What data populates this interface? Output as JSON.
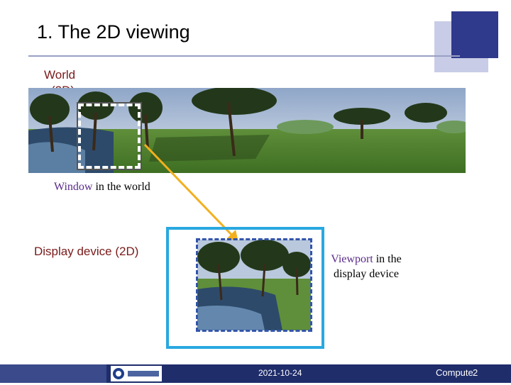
{
  "slide": {
    "title": "1. The 2D viewing",
    "world_label_line1": "World",
    "world_label_line2": "(2D)",
    "window_label_accent": "Window",
    "window_label_rest": " in the world",
    "display_label": "Display device (2D)",
    "viewport_label_accent": "Viewport",
    "viewport_label_rest": " in the display device"
  },
  "footer": {
    "date": "2021-10-24",
    "course": "Compute",
    "page": "2",
    "logo_text": "한양대학교"
  },
  "colors": {
    "accent_purple": "#5a2a8a",
    "label_dark_red": "#7a1a1a",
    "arrow_orange": "#f2b01e",
    "frame_cyan": "#29a8e0",
    "footer_navy": "#1f2d6b"
  }
}
